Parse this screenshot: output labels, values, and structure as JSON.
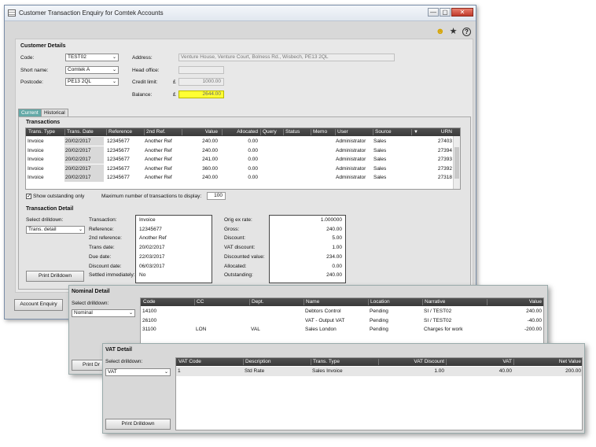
{
  "window": {
    "title": "Customer Transaction Enquiry for Comtek Accounts",
    "buttons": [
      "—",
      "▢",
      "✕"
    ]
  },
  "toolbar_icons": [
    "smiley-icon",
    "star-icon",
    "help-icon"
  ],
  "customer": {
    "heading": "Customer Details",
    "code_label": "Code:",
    "code": "TEST02",
    "short_name_label": "Short name:",
    "short_name": "Comtek A",
    "postcode_label": "Postcode:",
    "postcode": "PE13 2QL",
    "address_label": "Address:",
    "address": "Venture House, Venture Court, Bolness Rd., Wisbech, PE13 2QL",
    "head_office_label": "Head office:",
    "credit_limit_label": "Credit limit:",
    "credit_limit": "1000.00",
    "balance_label": "Balance:",
    "balance": "2644.00",
    "currency": "£"
  },
  "tabs": [
    "Current",
    "Historical"
  ],
  "transactions": {
    "heading": "Transactions",
    "columns": [
      "Trans. Type",
      "Trans. Date",
      "Reference",
      "2nd Ref.",
      "Value",
      "Allocated",
      "Query",
      "Status",
      "Memo",
      "User",
      "Source",
      "URN"
    ],
    "sort_arrow": "▼",
    "rows": [
      [
        "Invoice",
        "20/02/2017",
        "12345677",
        "Another Ref",
        "240.00",
        "0.00",
        "",
        "",
        "",
        "Administrator",
        "Sales",
        "27403"
      ],
      [
        "Invoice",
        "20/02/2017",
        "12345677",
        "Another Ref",
        "240.00",
        "0.00",
        "",
        "",
        "",
        "Administrator",
        "Sales",
        "27394"
      ],
      [
        "Invoice",
        "20/02/2017",
        "12345677",
        "Another Ref",
        "241.00",
        "0.00",
        "",
        "",
        "",
        "Administrator",
        "Sales",
        "27393"
      ],
      [
        "Invoice",
        "20/02/2017",
        "12345677",
        "Another Ref",
        "360.00",
        "0.00",
        "",
        "",
        "",
        "Administrator",
        "Sales",
        "27392"
      ],
      [
        "Invoice",
        "20/02/2017",
        "12345677",
        "Another Ref",
        "240.00",
        "0.00",
        "",
        "",
        "",
        "Administrator",
        "Sales",
        "27318"
      ]
    ],
    "show_outstanding_label": "Show outstanding only",
    "max_label": "Maximum number of transactions to display:",
    "max_value": "100"
  },
  "detail": {
    "heading": "Transaction Detail",
    "drilldown_label": "Select drilldown:",
    "drilldown_value": "Trans. detail",
    "print_button": "Print Drilldown",
    "labels": [
      "Transaction:",
      "Reference:",
      "2nd reference:",
      "Trans date:",
      "Due date:",
      "Discount date:",
      "Settled immediately:"
    ],
    "values": [
      "Invoice",
      "12345677",
      "Another Ref",
      "20/02/2017",
      "22/03/2017",
      "06/03/2017",
      "No"
    ],
    "labels2": [
      "Orig ex rate:",
      "Gross:",
      "Discount:",
      "VAT discount:",
      "Discounted value:",
      "Allocated:",
      "Outstanding:"
    ],
    "values2": [
      "1.000000",
      "240.00",
      "5.00",
      "1.00",
      "234.00",
      "0.00",
      "240.00"
    ]
  },
  "account_enquiry_button": "Account Enquiry",
  "nominal": {
    "heading": "Nominal Detail",
    "drilldown_label": "Select drilldown:",
    "drilldown_value": "Nominal",
    "print_button": "Print Dr",
    "columns": [
      "Code",
      "CC",
      "Dept.",
      "Name",
      "Location",
      "Narrative",
      "Value"
    ],
    "rows": [
      [
        "14100",
        "",
        "",
        "Debtors Control",
        "Pending",
        "SI / TEST02",
        "240.00"
      ],
      [
        "26100",
        "",
        "",
        "VAT - Output VAT",
        "Pending",
        "SI / TEST02",
        "-40.00"
      ],
      [
        "31100",
        "LON",
        "VAL",
        "Sales London",
        "Pending",
        "Charges for work",
        "-200.00"
      ]
    ]
  },
  "vat": {
    "heading": "VAT Detail",
    "drilldown_label": "Select drilldown:",
    "drilldown_value": "VAT",
    "print_button": "Print Drilldown",
    "columns": [
      "VAT Code",
      "Description",
      "Trans. Type",
      "VAT Discount",
      "VAT",
      "Net Value"
    ],
    "rows": [
      [
        "1",
        "Std Rate",
        "Sales Invoice",
        "1.00",
        "40.00",
        "200.00"
      ]
    ]
  },
  "colors": {
    "tab_active": "#64a9a7",
    "balance_bg": "#ffff33",
    "header_bg": "#3f3f3f"
  }
}
